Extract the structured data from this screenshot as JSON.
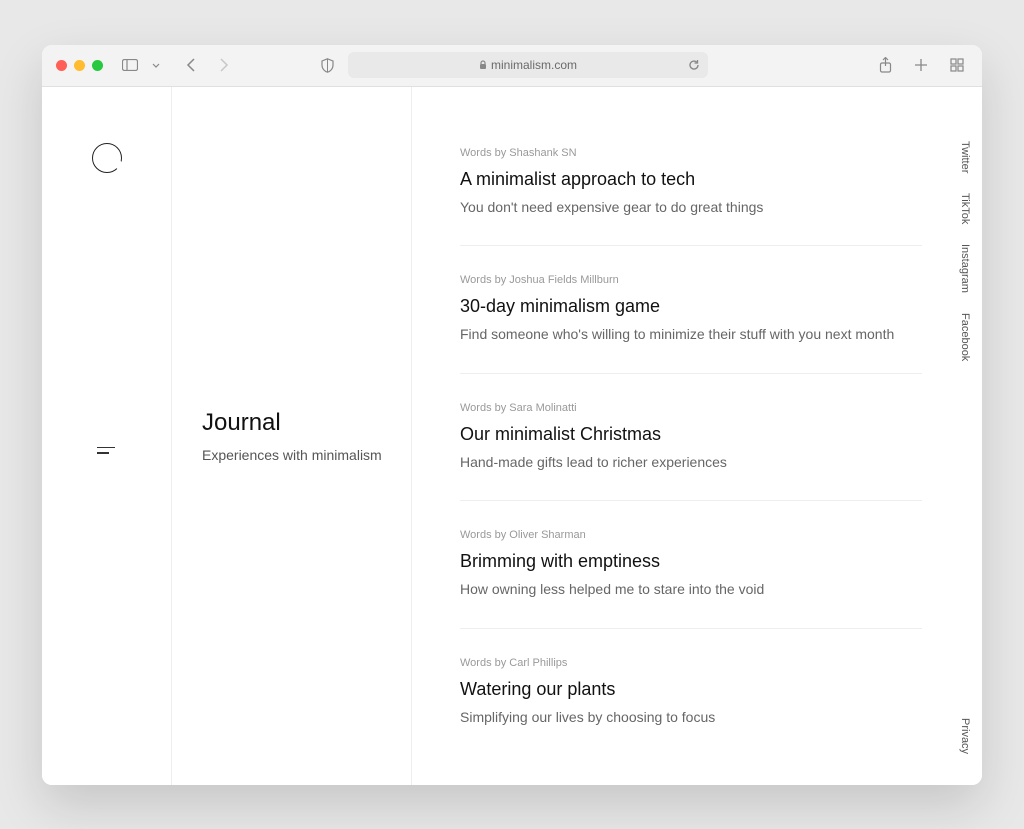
{
  "browser": {
    "url": "minimalism.com"
  },
  "sidebar": {
    "title": "Journal",
    "subtitle": "Experiences with minimalism"
  },
  "articles": [
    {
      "byline": "Words by Shashank SN",
      "title": "A minimalist approach to tech",
      "excerpt": "You don't need expensive gear to do great things"
    },
    {
      "byline": "Words by Joshua Fields Millburn",
      "title": "30-day minimalism game",
      "excerpt": "Find someone who's willing to minimize their stuff with you next month"
    },
    {
      "byline": "Words by Sara Molinatti",
      "title": "Our minimalist Christmas",
      "excerpt": "Hand-made gifts lead to richer experiences"
    },
    {
      "byline": "Words by Oliver Sharman",
      "title": "Brimming with emptiness",
      "excerpt": "How owning less helped me to stare into the void"
    },
    {
      "byline": "Words by Carl Phillips",
      "title": "Watering our plants",
      "excerpt": "Simplifying our lives by choosing to focus"
    }
  ],
  "social": {
    "twitter": "Twitter",
    "tiktok": "TikTok",
    "instagram": "Instagram",
    "facebook": "Facebook",
    "privacy": "Privacy"
  }
}
